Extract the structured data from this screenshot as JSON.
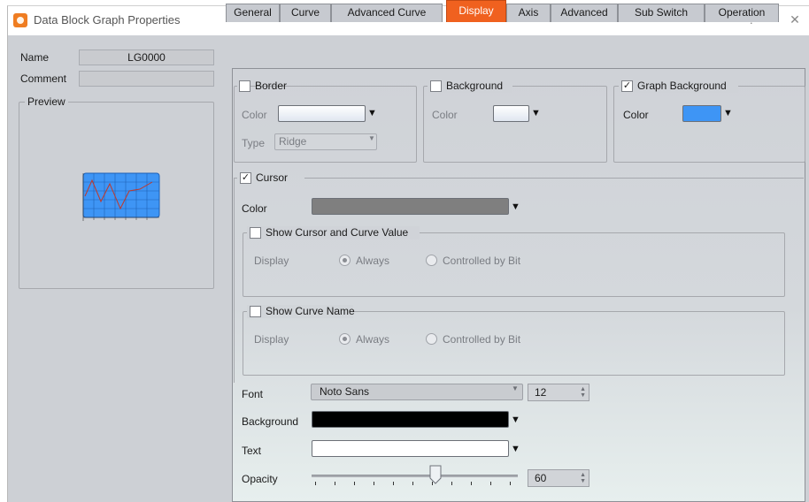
{
  "window": {
    "title": "Data Block Graph Properties",
    "help_glyph": "?",
    "close_glyph": "✕",
    "icon": "app-icon"
  },
  "left": {
    "name_label": "Name",
    "name_value": "LG0000",
    "comment_label": "Comment",
    "comment_value": "",
    "preview_label": "Preview"
  },
  "tabs": [
    {
      "label": "General"
    },
    {
      "label": "Curve"
    },
    {
      "label": "Advanced Curve"
    },
    {
      "label": "Display",
      "active": true
    },
    {
      "label": "Axis"
    },
    {
      "label": "Advanced"
    },
    {
      "label": "Sub Switch"
    },
    {
      "label": "Operation"
    }
  ],
  "display": {
    "border": {
      "title": "Border",
      "checked": false,
      "color_label": "Color",
      "type_label": "Type",
      "type_value": "Ridge"
    },
    "background": {
      "title": "Background",
      "checked": false,
      "color_label": "Color"
    },
    "graph_background": {
      "title": "Graph Background",
      "checked": true,
      "color_label": "Color",
      "color_hex": "#3e95f5"
    },
    "cursor": {
      "title": "Cursor",
      "checked": true,
      "color_label": "Color",
      "color_hex": "#7f7f7f",
      "show_value": {
        "title": "Show Cursor and Curve Value",
        "checked": false,
        "display_label": "Display",
        "opt_always": "Always",
        "opt_bit": "Controlled by Bit"
      },
      "show_name": {
        "title": "Show Curve Name",
        "checked": false,
        "display_label": "Display",
        "opt_always": "Always",
        "opt_bit": "Controlled by Bit"
      }
    },
    "font_label": "Font",
    "font_value": "Noto Sans",
    "font_size": "12",
    "background_label": "Background",
    "background_hex": "#000000",
    "text_label": "Text",
    "text_hex": "#ffffff",
    "opacity_label": "Opacity",
    "opacity_value": "60",
    "opacity_fraction": 0.6
  },
  "colors": {
    "accent_tab": "#f0611f",
    "panel_bg": "#cdd0d5"
  }
}
